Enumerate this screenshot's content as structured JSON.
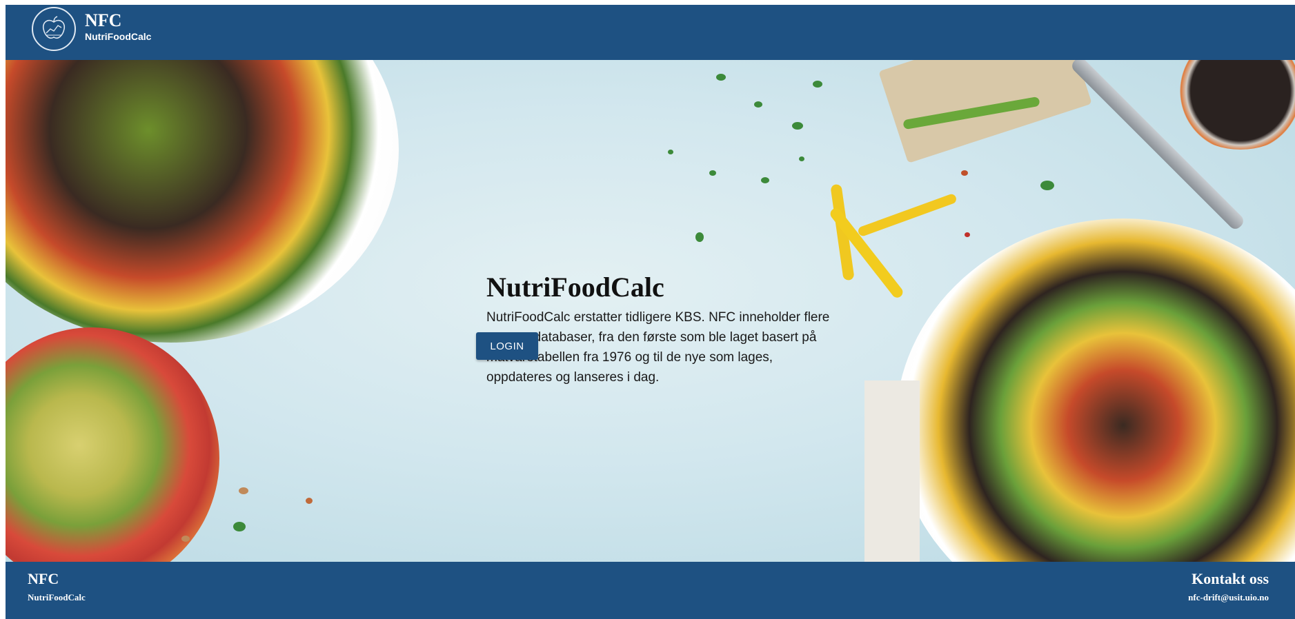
{
  "header": {
    "abbr": "NFC",
    "name": "NutriFoodCalc",
    "logo_icon": "apple-chart-logo-icon"
  },
  "hero": {
    "title": "NutriFoodCalc",
    "description": "NutriFoodCalc erstatter tidligere KBS. NFC inneholder flere matvaredatabaser, fra den første som ble laget basert på matvaretabellen fra 1976 og til de nye som lages, oppdateres og lanseres i dag.",
    "login_label": "LOGIN",
    "background": "food-bowls-photo"
  },
  "footer": {
    "abbr": "NFC",
    "name": "NutriFoodCalc",
    "contact_title": "Kontakt oss",
    "contact_email": "nfc-drift@usit.uio.no"
  },
  "colors": {
    "brand": "#1e5182",
    "background": "#d2e7ee"
  }
}
